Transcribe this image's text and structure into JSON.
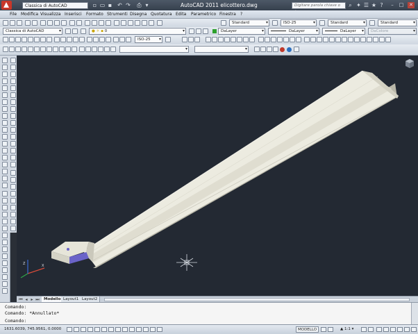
{
  "titlebar": {
    "workspace": "Classica di AutoCAD",
    "title": "AutoCAD 2011    elicottero.dwg",
    "search_placeholder": "Digitare parola chiave o frase",
    "window_controls": [
      "–",
      "□",
      "✕"
    ]
  },
  "menubar": {
    "items": [
      "File",
      "Modifica",
      "Visualizza",
      "Inserisci",
      "Formato",
      "Strumenti",
      "Disegna",
      "Quotatura",
      "Edita",
      "Parametrico",
      "Finestra",
      "?"
    ]
  },
  "toolbars": {
    "workspace_dropdown": "Classica di AutoCAD",
    "layer_dropdown": "0",
    "text_style": "Standard",
    "dim_style": "ISO-25",
    "table_style": "Standard",
    "mleader_style": "Standard",
    "color_dropdown": "DaLayer",
    "linetype_dropdown": "DaLayer",
    "lineweight_dropdown": "DaLayer",
    "plotstyle_dropdown": "DaColore",
    "visual_dim_style": "ISO-25",
    "empty_dropdown": ""
  },
  "tabs": {
    "items": [
      "Modello",
      "Layout1",
      "Layout2"
    ],
    "active": "Modello"
  },
  "command": {
    "lines": [
      "Comando:",
      "Comando: *Annullato*",
      "Comando:"
    ]
  },
  "statusbar": {
    "coords": "1631.6039, 745.9561, 0.0000",
    "model_label": "MODELLO",
    "scale": "▲ 1:1 ▾"
  },
  "colors": {
    "titlebar": "#3f4956",
    "drawing_bg": "#232933",
    "model_face": "#eceade",
    "model_shadow": "#b8b6a8",
    "accent_face": "#6a63c8"
  }
}
